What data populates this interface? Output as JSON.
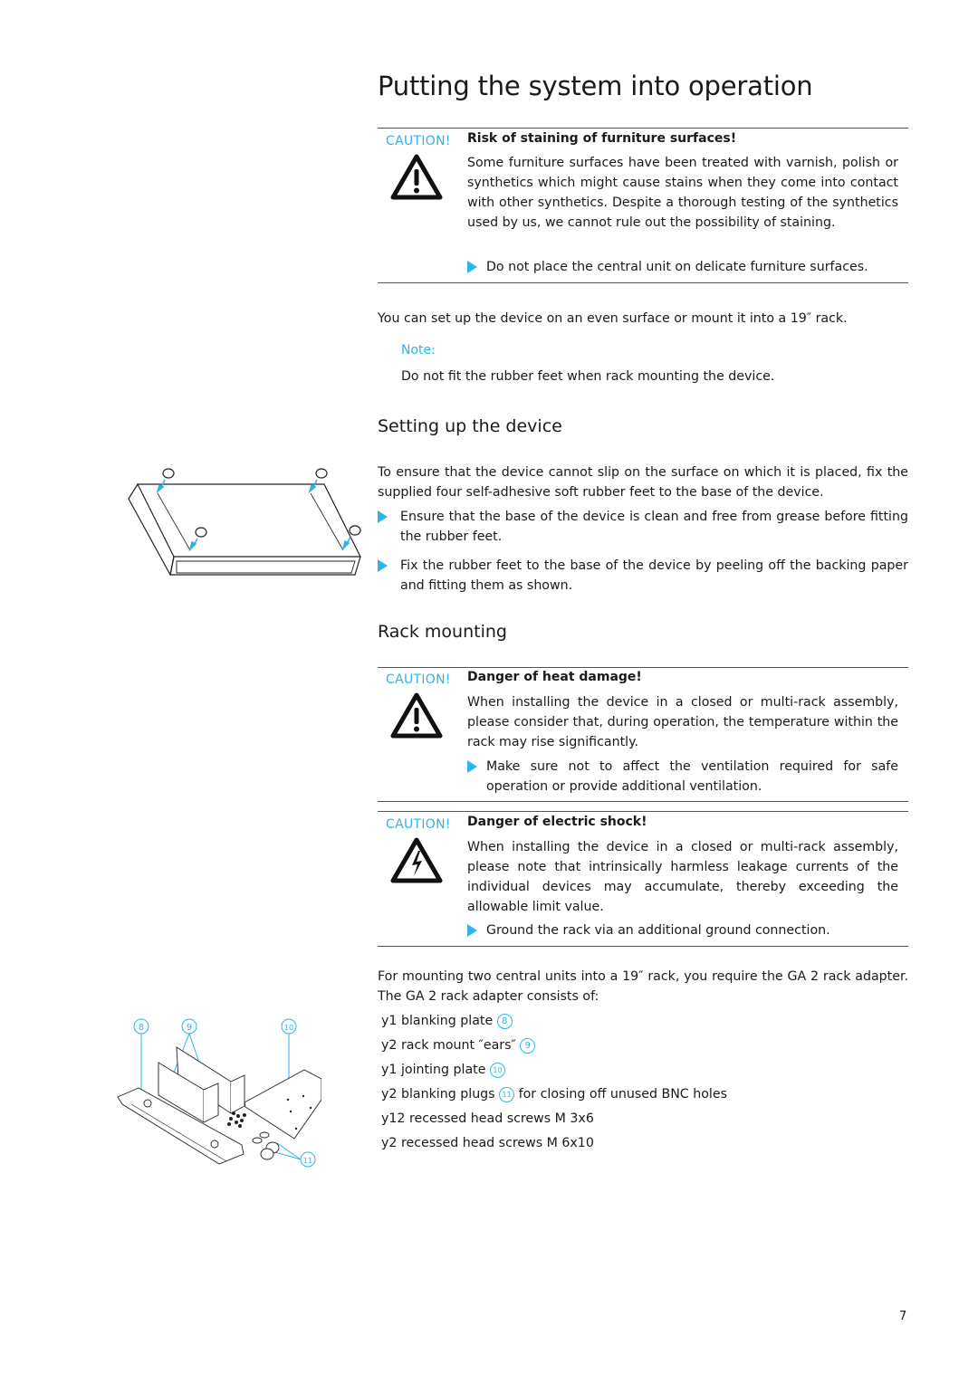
{
  "page": {
    "title": "Putting the system into operation",
    "page_number": "7"
  },
  "caution_staining": {
    "label": "CAUTION!",
    "icon": "warning-triangle-icon",
    "heading": "Risk of staining of furniture surfaces!",
    "text": "Some furniture surfaces have been treated with varnish, polish or synthetics which might cause stains when they come into contact with other synthetics. Despite a thorough testing of the synthetics used by us, we cannot rule out the possibility of staining.",
    "action": "Do not place the central unit on delicate furniture surfaces."
  },
  "intro": {
    "text": "You can set up the device on an even surface or mount it into a 19″ rack.",
    "note_label": "Note:",
    "note_text": "Do not fit the rubber feet when rack mounting the device."
  },
  "setup": {
    "heading": "Setting up the device",
    "text": "To ensure that the device cannot slip on the surface on which it is placed, fix the supplied four self-adhesive soft rubber feet to the base of the device.",
    "steps": [
      "Ensure that the base of the device is clean and free from grease before fitting the rubber feet.",
      "Fix the rubber feet to the base of the device by peeling off the backing paper and fitting them as shown."
    ]
  },
  "rack": {
    "heading": "Rack mounting",
    "caution_heat": {
      "label": "CAUTION!",
      "icon": "warning-triangle-icon",
      "heading": "Danger of heat damage!",
      "text": "When installing the device in a closed or multi-rack assembly, please consider that, during operation, the temperature within the rack may rise significantly.",
      "action": "Make sure not to affect the ventilation required for safe operation or provide additional ventilation."
    },
    "caution_shock": {
      "label": "CAUTION!",
      "icon": "electric-shock-icon",
      "heading": "Danger of electric shock!",
      "text": "When installing the device in a closed or multi-rack assembly, please note that intrinsically harmless leakage currents of the individual devices may accumulate, thereby exceeding the allowable limit value.",
      "action": "Ground the rack via an additional ground connection."
    },
    "text": "For mounting two central units into a 19″ rack, you require the GA 2 rack adapter. The GA 2 rack adapter consists of:",
    "items": [
      {
        "marker": "y",
        "text": "1 blanking plate",
        "ref": "8",
        "suffix": ""
      },
      {
        "marker": "y",
        "text": "2 rack mount ″ears″",
        "ref": "9",
        "suffix": ""
      },
      {
        "marker": "y",
        "text": "1 jointing plate",
        "ref": "10",
        "suffix": ""
      },
      {
        "marker": "y",
        "text": "2 blanking plugs",
        "ref": "11",
        "suffix": "for closing off unused BNC holes"
      },
      {
        "marker": "y",
        "text": "12 recessed head screws M 3x6",
        "ref": "",
        "suffix": ""
      },
      {
        "marker": "y",
        "text": "2 recessed head screws M 6x10",
        "ref": "",
        "suffix": ""
      }
    ]
  },
  "figures": {
    "rubber_feet": {
      "icon": "device-base-rubber-feet-illustration"
    },
    "rack_adapter": {
      "labels": [
        "8",
        "9",
        "10",
        "11"
      ]
    }
  },
  "colors": {
    "accent": "#2bb5ea",
    "text": "#1a1a1a",
    "rule": "#555555"
  }
}
